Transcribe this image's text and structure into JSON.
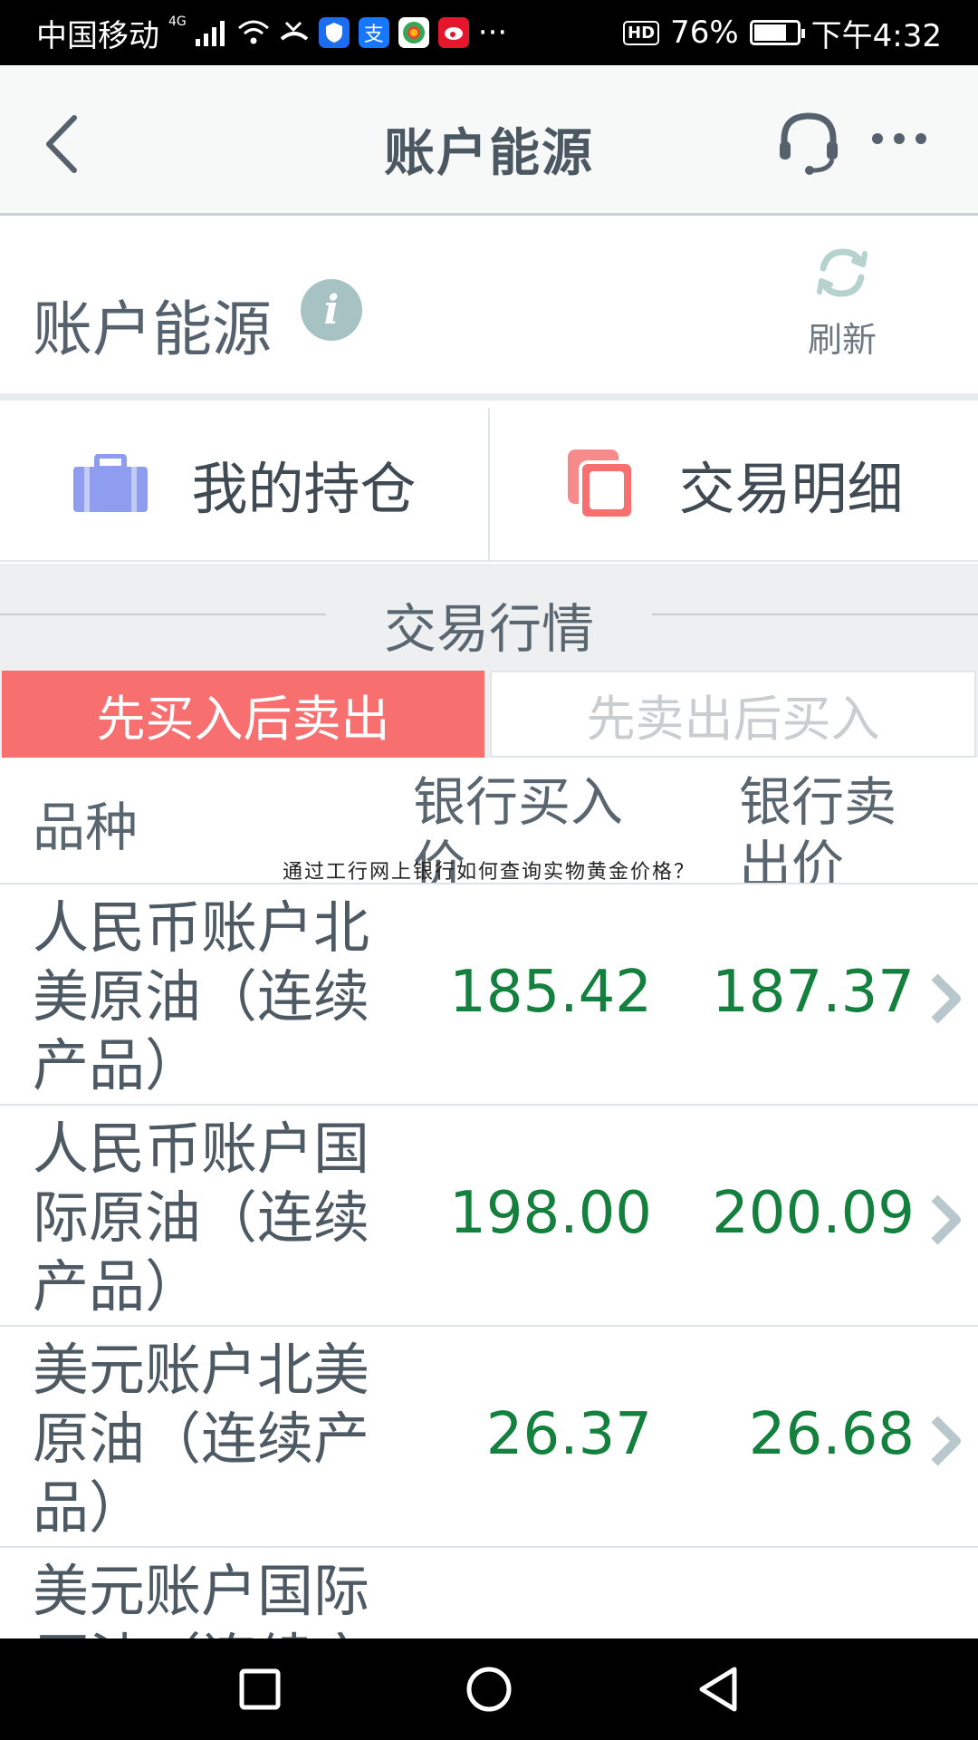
{
  "status_bar": {
    "carrier": "中国移动",
    "network_gen": "4G",
    "battery_percent": "76%",
    "battery_level": 0.76,
    "time": "下午4:32",
    "more": "···",
    "hd": "HD"
  },
  "header": {
    "title": "账户能源"
  },
  "account": {
    "title": "账户能源",
    "info_glyph": "i",
    "refresh_label": "刷新"
  },
  "entries": {
    "holdings_label": "我的持仓",
    "transactions_label": "交易明细"
  },
  "quotes": {
    "section_title": "交易行情",
    "tabs": [
      {
        "label": "先买入后卖出",
        "active": true
      },
      {
        "label": "先卖出后买入",
        "active": false
      }
    ],
    "columns": {
      "name": "品种",
      "bank_buy": "银行买入价",
      "bank_sell": "银行卖出价"
    },
    "rows": [
      {
        "name": "人民币账户北美原油（连续产品）",
        "bank_buy": "185.42",
        "bank_sell": "187.37"
      },
      {
        "name": "人民币账户国际原油（连续产品）",
        "bank_buy": "198.00",
        "bank_sell": "200.09"
      },
      {
        "name": "美元账户北美原油（连续产品）",
        "bank_buy": "26.37",
        "bank_sell": "26.68"
      },
      {
        "name": "美元账户国际原油（连续产品）",
        "bank_buy": "",
        "bank_sell": ""
      }
    ]
  },
  "watermark": "通过工行网上银行如何查询实物黄金价格？",
  "icons": [
    "back-arrow-icon",
    "headset-icon",
    "more-icon",
    "info-icon",
    "refresh-icon",
    "briefcase-icon",
    "copy-icon",
    "chevron-right-icon"
  ],
  "colors": {
    "accent_red": "#f76f6f",
    "price_green": "#13813d",
    "briefcase_blue": "#8f9df0"
  }
}
